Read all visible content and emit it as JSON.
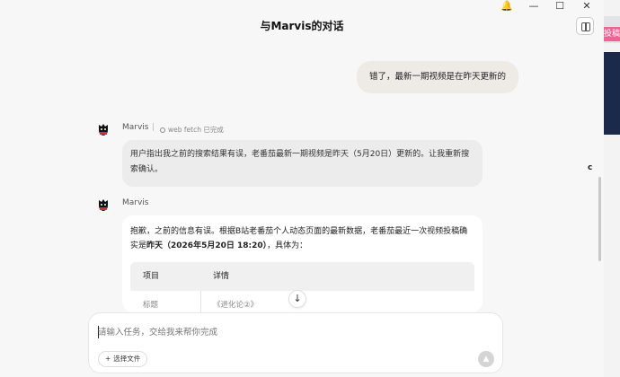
{
  "window": {
    "title": "与Marvis的对话",
    "controls": {
      "notify": "🔔",
      "minimize": "—",
      "maximize": "☐",
      "close": "✕"
    }
  },
  "background_app": {
    "badge_text": "投稿"
  },
  "messages": {
    "user": {
      "text": "错了，最新一期视频是在昨天更新的"
    },
    "assistant1": {
      "sender": "Marvis",
      "separator": "|",
      "tool_status": "web fetch 已完成",
      "text": "用户指出我之前的搜索结果有误，老番茄最新一期视频是昨天（5月20日）更新的。让我重新搜索确认。"
    },
    "assistant2": {
      "sender": "Marvis",
      "text_pre": "抱歉，之前的信息有误。根据B站老番茄个人动态页面的最新数据，老番茄最近一次视频投稿确实是",
      "text_bold": "昨天（2026年5月20日 18:20）",
      "text_post": "，具体为：",
      "table": {
        "headers": [
          "项目",
          "详情"
        ],
        "rows": [
          [
            "标题",
            "《进化论②》"
          ]
        ]
      }
    }
  },
  "side_glyph": "c",
  "composer": {
    "placeholder": "请输入任务，交给我来帮你完成",
    "file_button": "选择文件",
    "file_button_icon": "+",
    "send_icon": "▲",
    "scroll_down_icon": "↓"
  },
  "colors": {
    "user_bubble": "#eeeae6",
    "assistant_bubble": "#ececec",
    "accent_pink": "#f06292"
  }
}
